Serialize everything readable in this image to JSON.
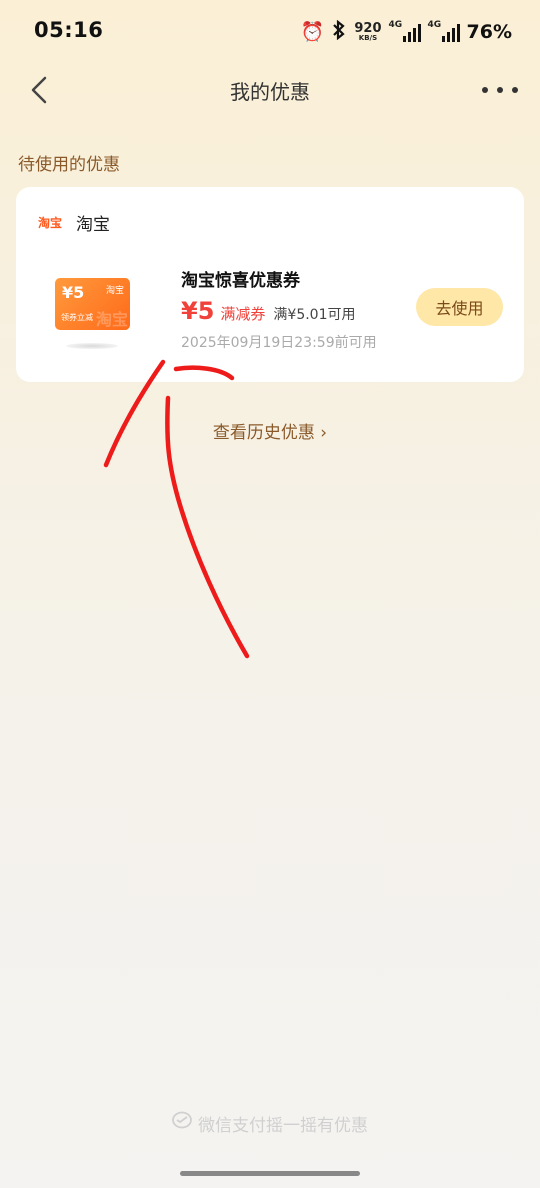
{
  "status_bar": {
    "time": "05:16",
    "net_speed_value": "920",
    "net_speed_unit": "KB/S",
    "sim1_tag": "4G",
    "sim2_tag": "4G",
    "battery": "76%"
  },
  "nav": {
    "title": "我的优惠"
  },
  "section": {
    "title": "待使用的优惠"
  },
  "coupon": {
    "brand_logo": "淘宝",
    "brand_name": "淘宝",
    "img_amount": "¥5",
    "img_brand": "淘宝",
    "img_label": "领券立减",
    "img_watermark": "淘宝",
    "title": "淘宝惊喜优惠券",
    "price": "¥5",
    "type": "满减券",
    "condition": "满¥5.01可用",
    "valid_until": "2025年09月19日23:59前可用",
    "button": "去使用"
  },
  "history": {
    "label": "查看历史优惠 ›"
  },
  "footer": {
    "text": "微信支付摇一摇有优惠"
  },
  "colors": {
    "accent_brown": "#8a5a2a",
    "price_red": "#f0423a",
    "button_bg": "#ffe7a7",
    "annotation_red": "#ee1b1b"
  }
}
